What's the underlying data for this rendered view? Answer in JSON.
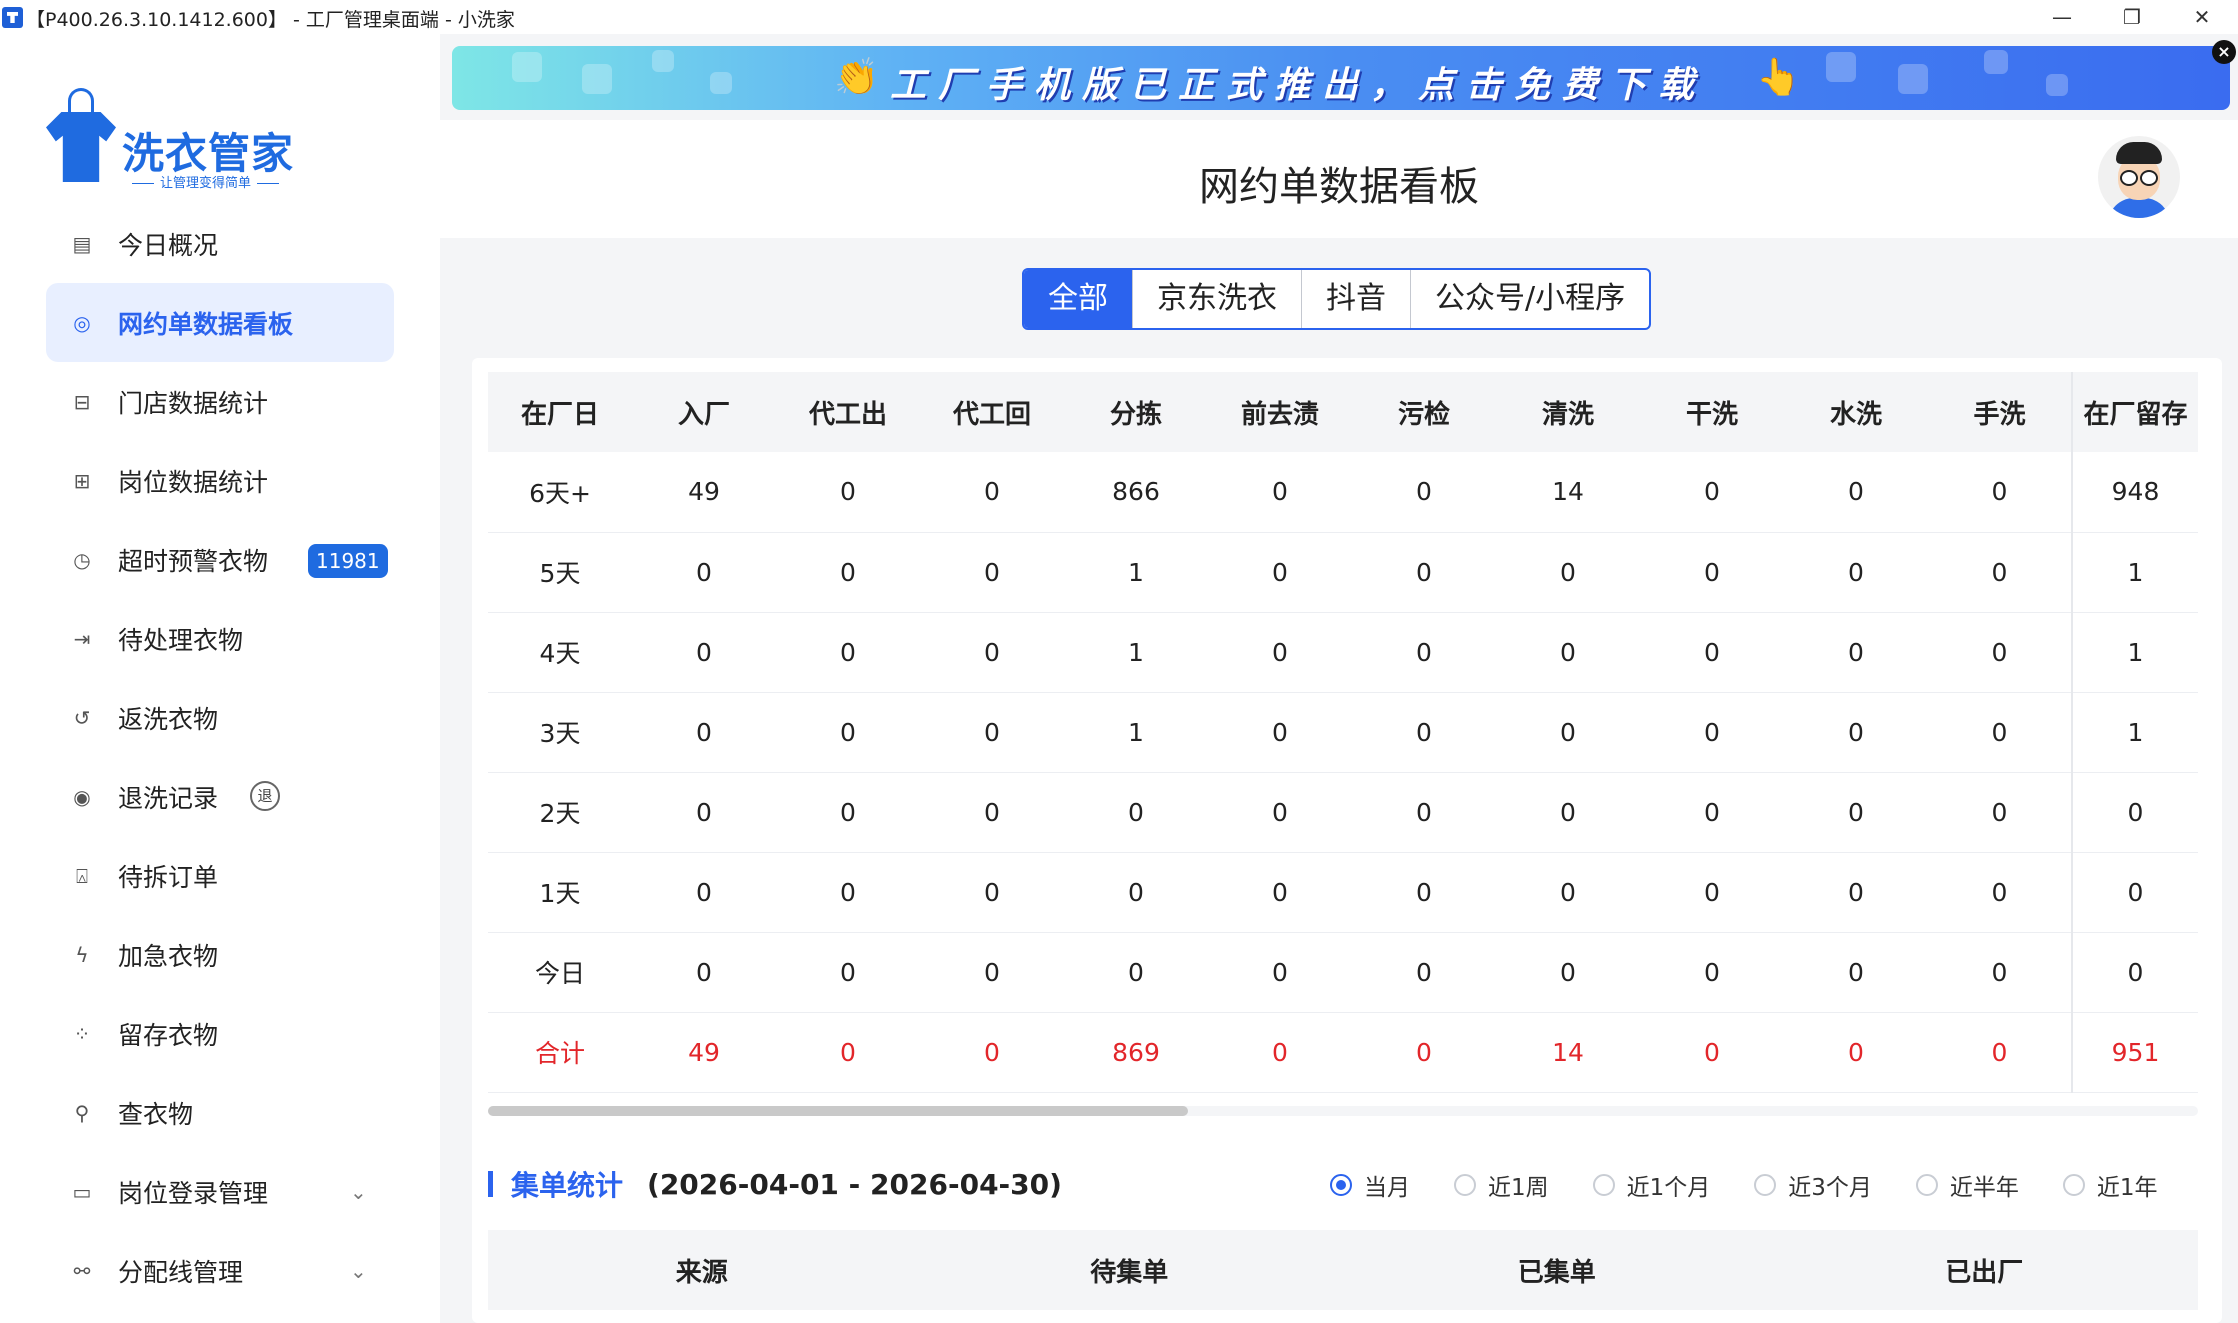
{
  "window": {
    "title": "【P400.26.3.10.1412.600】 - 工厂管理桌面端 - 小洗家",
    "minimize_glyph": "—",
    "restore_glyph": "❐",
    "close_glyph": "✕"
  },
  "logo": {
    "title": "洗衣管家",
    "subtitle": "让管理变得简单"
  },
  "sidebar": {
    "items": [
      {
        "label": "今日概况",
        "icon": "calendar-icon",
        "glyph": "▤"
      },
      {
        "label": "网约单数据看板",
        "icon": "dashboard-icon",
        "glyph": "◎",
        "active": true
      },
      {
        "label": "门店数据统计",
        "icon": "store-icon",
        "glyph": "⊟"
      },
      {
        "label": "岗位数据统计",
        "icon": "post-icon",
        "glyph": "⊞"
      },
      {
        "label": "超时预警衣物",
        "icon": "clock-icon",
        "glyph": "◷",
        "badge": "11981"
      },
      {
        "label": "待处理衣物",
        "icon": "pending-icon",
        "glyph": "⇥"
      },
      {
        "label": "返洗衣物",
        "icon": "return-icon",
        "glyph": "↺"
      },
      {
        "label": "退洗记录",
        "icon": "refund-icon",
        "glyph": "◉",
        "tag": "退"
      },
      {
        "label": "待拆订单",
        "icon": "split-icon",
        "glyph": "⍓"
      },
      {
        "label": "加急衣物",
        "icon": "urgent-icon",
        "glyph": "ϟ"
      },
      {
        "label": "留存衣物",
        "icon": "storage-icon",
        "glyph": "⁘"
      },
      {
        "label": "查衣物",
        "icon": "search-icon",
        "glyph": "⚲"
      },
      {
        "label": "岗位登录管理",
        "icon": "monitor-icon",
        "glyph": "▭",
        "expandable": true
      },
      {
        "label": "分配线管理",
        "icon": "hierarchy-icon",
        "glyph": "⚯",
        "expandable": true
      }
    ],
    "chevron_glyph": "⌄"
  },
  "banner": {
    "text": "工厂手机版已正式推出，点击免费下载",
    "close_glyph": "×"
  },
  "header": {
    "title": "网约单数据看板"
  },
  "tabs": [
    {
      "label": "全部",
      "active": true
    },
    {
      "label": "京东洗衣"
    },
    {
      "label": "抖音"
    },
    {
      "label": "公众号/小程序"
    }
  ],
  "grid": {
    "columns": [
      "在厂日",
      "入厂",
      "代工出",
      "代工回",
      "分拣",
      "前去渍",
      "污检",
      "清洗",
      "干洗",
      "水洗",
      "手洗",
      "在厂留存"
    ],
    "rows": [
      [
        "6天+",
        "49",
        "0",
        "0",
        "866",
        "0",
        "0",
        "14",
        "0",
        "0",
        "0",
        "948"
      ],
      [
        "5天",
        "0",
        "0",
        "0",
        "1",
        "0",
        "0",
        "0",
        "0",
        "0",
        "0",
        "1"
      ],
      [
        "4天",
        "0",
        "0",
        "0",
        "1",
        "0",
        "0",
        "0",
        "0",
        "0",
        "0",
        "1"
      ],
      [
        "3天",
        "0",
        "0",
        "0",
        "1",
        "0",
        "0",
        "0",
        "0",
        "0",
        "0",
        "1"
      ],
      [
        "2天",
        "0",
        "0",
        "0",
        "0",
        "0",
        "0",
        "0",
        "0",
        "0",
        "0",
        "0"
      ],
      [
        "1天",
        "0",
        "0",
        "0",
        "0",
        "0",
        "0",
        "0",
        "0",
        "0",
        "0",
        "0"
      ],
      [
        "今日",
        "0",
        "0",
        "0",
        "0",
        "0",
        "0",
        "0",
        "0",
        "0",
        "0",
        "0"
      ],
      [
        "合计",
        "49",
        "0",
        "0",
        "869",
        "0",
        "0",
        "14",
        "0",
        "0",
        "0",
        "951"
      ]
    ],
    "total_color": "#e2262a"
  },
  "collect": {
    "title": "集单统计",
    "range": "(2026-04-01 - 2026-04-30)",
    "periods": [
      {
        "label": "当月",
        "checked": true
      },
      {
        "label": "近1周"
      },
      {
        "label": "近1个月"
      },
      {
        "label": "近3个月"
      },
      {
        "label": "近半年"
      },
      {
        "label": "近1年"
      }
    ],
    "columns": [
      "来源",
      "待集单",
      "已集单",
      "已出厂"
    ]
  },
  "colors": {
    "accent": "#2b63ee",
    "brand": "#1f6be0",
    "badge_bg": "#1f6be0"
  }
}
